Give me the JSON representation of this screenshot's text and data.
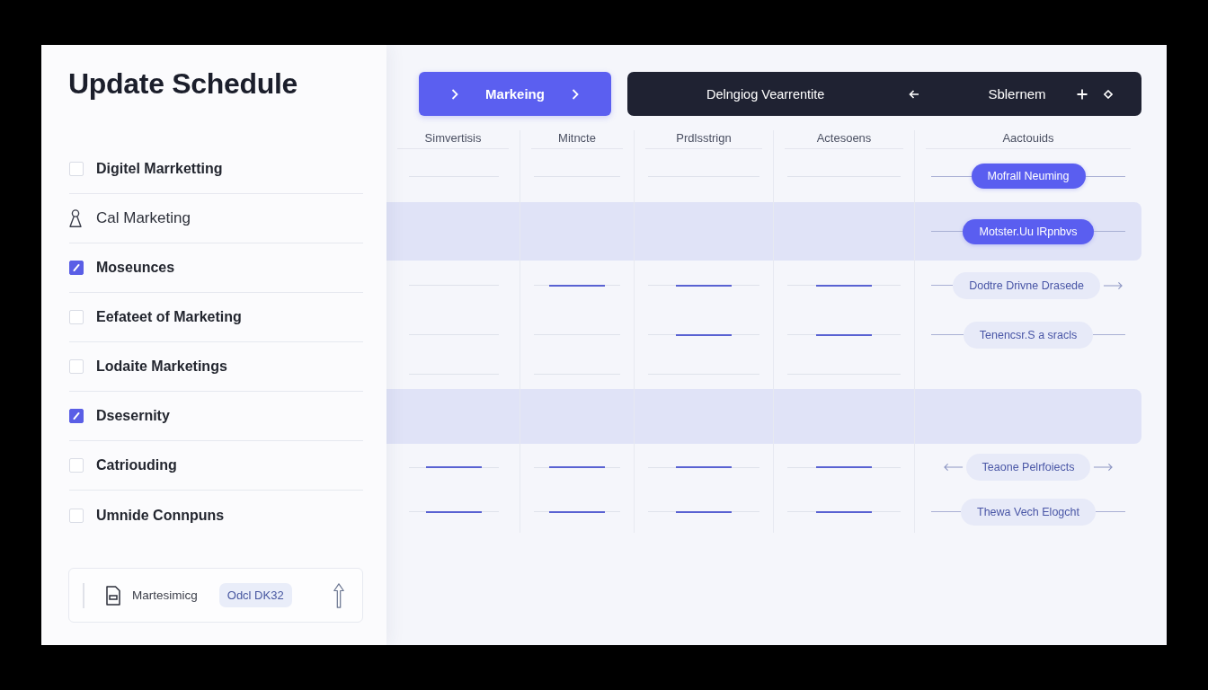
{
  "sidebar": {
    "title": "Update Schedule",
    "items": [
      {
        "kind": "checkbox",
        "label": "Digitel Marrketting",
        "checked": false
      },
      {
        "kind": "person",
        "label": "Cal Marketing"
      },
      {
        "kind": "checkbox",
        "label": "Moseunces",
        "checked": true
      },
      {
        "kind": "checkbox",
        "label": "Eefateet of Marketing",
        "checked": false
      },
      {
        "kind": "checkbox",
        "label": "Lodaite Marketings",
        "checked": false
      },
      {
        "kind": "checkbox",
        "label": "Dsesernity",
        "checked": true
      },
      {
        "kind": "checkbox",
        "label": "Catriouding",
        "checked": false
      },
      {
        "kind": "checkbox",
        "label": "Umnide Connpuns",
        "checked": false
      }
    ],
    "footer": {
      "label": "Martesimicg",
      "tag": "Odcl DK32"
    }
  },
  "toolbar": {
    "primary_label": "Markeing",
    "title": "Delngiog Vearrentite",
    "label": "Sblernem"
  },
  "grid": {
    "columns": [
      "Simvertisis",
      "Mitncte",
      "Prdlsstrign",
      "Actesoens",
      "Aactouids"
    ],
    "rows": [
      {
        "selected": false,
        "cells": [
          {
            "active": false
          },
          {
            "active": false
          },
          {
            "active": false
          },
          {
            "active": false
          }
        ],
        "tag": {
          "label": "Mofrall Neuming",
          "kind": "filled",
          "arrow_left": false,
          "arrow_right": false
        }
      },
      {
        "selected": true,
        "tag": {
          "label": "Motster.Uu lRpnbvs",
          "kind": "filled",
          "arrow_left": false,
          "arrow_right": false
        }
      },
      {
        "selected": false,
        "cells": [
          {
            "active": false
          },
          {
            "active": true
          },
          {
            "active": true
          },
          {
            "active": true
          }
        ],
        "tag": {
          "label": "Dodtre Drivne Drasede",
          "kind": "soft",
          "arrow_left": false,
          "arrow_right": true
        }
      },
      {
        "selected": false,
        "cells": [
          {
            "active": false
          },
          {
            "active": false
          },
          {
            "active": true
          },
          {
            "active": true
          }
        ],
        "tag": {
          "label": "Tenencsr.S a sracls",
          "kind": "soft",
          "arrow_left": false,
          "arrow_right": false
        }
      },
      {
        "selected": false,
        "cells": [
          {
            "active": false
          },
          {
            "active": false
          },
          {
            "active": false
          },
          {
            "active": false
          }
        ]
      },
      {
        "selected": true
      },
      {
        "selected": false,
        "cells": [
          {
            "active": true
          },
          {
            "active": true
          },
          {
            "active": true
          },
          {
            "active": true
          }
        ],
        "tag": {
          "label": "Teaone Pelrfoiects",
          "kind": "soft",
          "arrow_left": true,
          "arrow_right": true
        }
      },
      {
        "selected": false,
        "cells": [
          {
            "active": true
          },
          {
            "active": true
          },
          {
            "active": true
          },
          {
            "active": true
          }
        ],
        "tag": {
          "label": "Thewa Vech Elogcht",
          "kind": "soft",
          "arrow_left": false,
          "arrow_right": false
        }
      }
    ]
  }
}
